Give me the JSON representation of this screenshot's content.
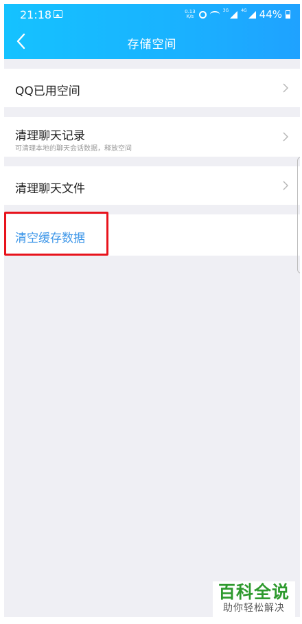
{
  "status_bar": {
    "time": "21:18",
    "speed_top": "0.13",
    "speed_unit": "K/s",
    "signal_1": "3G",
    "signal_2": "4G",
    "battery": "44%"
  },
  "header": {
    "title": "存储空间",
    "color": "#19b3ff"
  },
  "rows": [
    {
      "label": "QQ已用空间",
      "has_chevron": true
    },
    {
      "label": "清理聊天记录",
      "sub": "可清理本地的聊天会话数据，释放空间",
      "has_chevron": true
    },
    {
      "label": "清理聊天文件",
      "has_chevron": true
    },
    {
      "label": "清空缓存数据",
      "color": "#3b95e8",
      "highlighted": true
    }
  ],
  "highlight_color": "#e8131c",
  "watermark": {
    "title": "百科全说",
    "subtitle": "助你轻松解决"
  }
}
